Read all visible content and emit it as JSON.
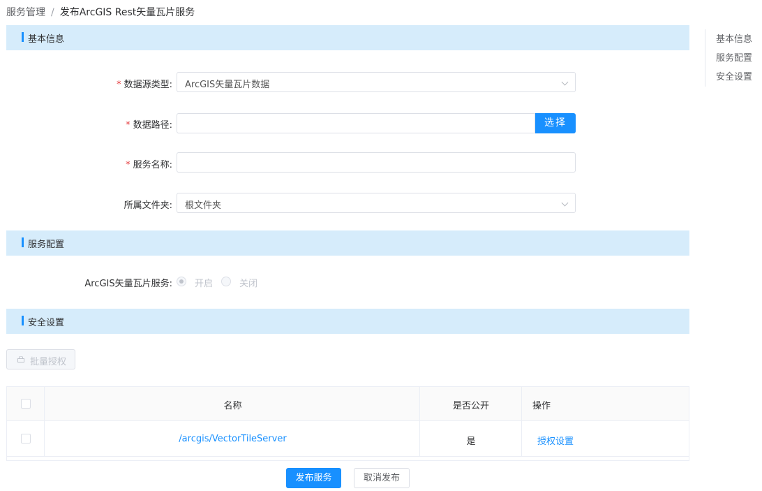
{
  "breadcrumb": {
    "parent": "服务管理",
    "separator": "/",
    "current": "发布ArcGIS Rest矢量瓦片服务"
  },
  "sections": {
    "basic": "基本信息",
    "service_config": "服务配置",
    "security": "安全设置"
  },
  "form": {
    "datasource_type": {
      "label": "数据源类型:",
      "value": "ArcGIS矢量瓦片数据",
      "required": true
    },
    "data_path": {
      "label": "数据路径:",
      "value": "",
      "button": "选择",
      "required": true
    },
    "service_name": {
      "label": "服务名称:",
      "value": "",
      "required": true
    },
    "folder": {
      "label": "所属文件夹:",
      "value": "根文件夹",
      "required": false
    },
    "required_mark": "*"
  },
  "service_config": {
    "label": "ArcGIS矢量瓦片服务:",
    "options": [
      {
        "label": "开启",
        "checked": true
      },
      {
        "label": "关闭",
        "checked": false
      }
    ]
  },
  "security": {
    "batch_button": "批量授权",
    "table": {
      "columns": [
        "名称",
        "是否公开",
        "操作"
      ],
      "rows": [
        {
          "name": "/arcgis/VectorTileServer",
          "public": "是",
          "action": "授权设置"
        }
      ]
    }
  },
  "footer": {
    "publish": "发布服务",
    "cancel": "取消发布"
  },
  "anchor_nav": [
    "基本信息",
    "服务配置",
    "安全设置"
  ],
  "colors": {
    "primary": "#1890ff",
    "section_bg": "#d6ecfb",
    "required": "#e4393c"
  }
}
